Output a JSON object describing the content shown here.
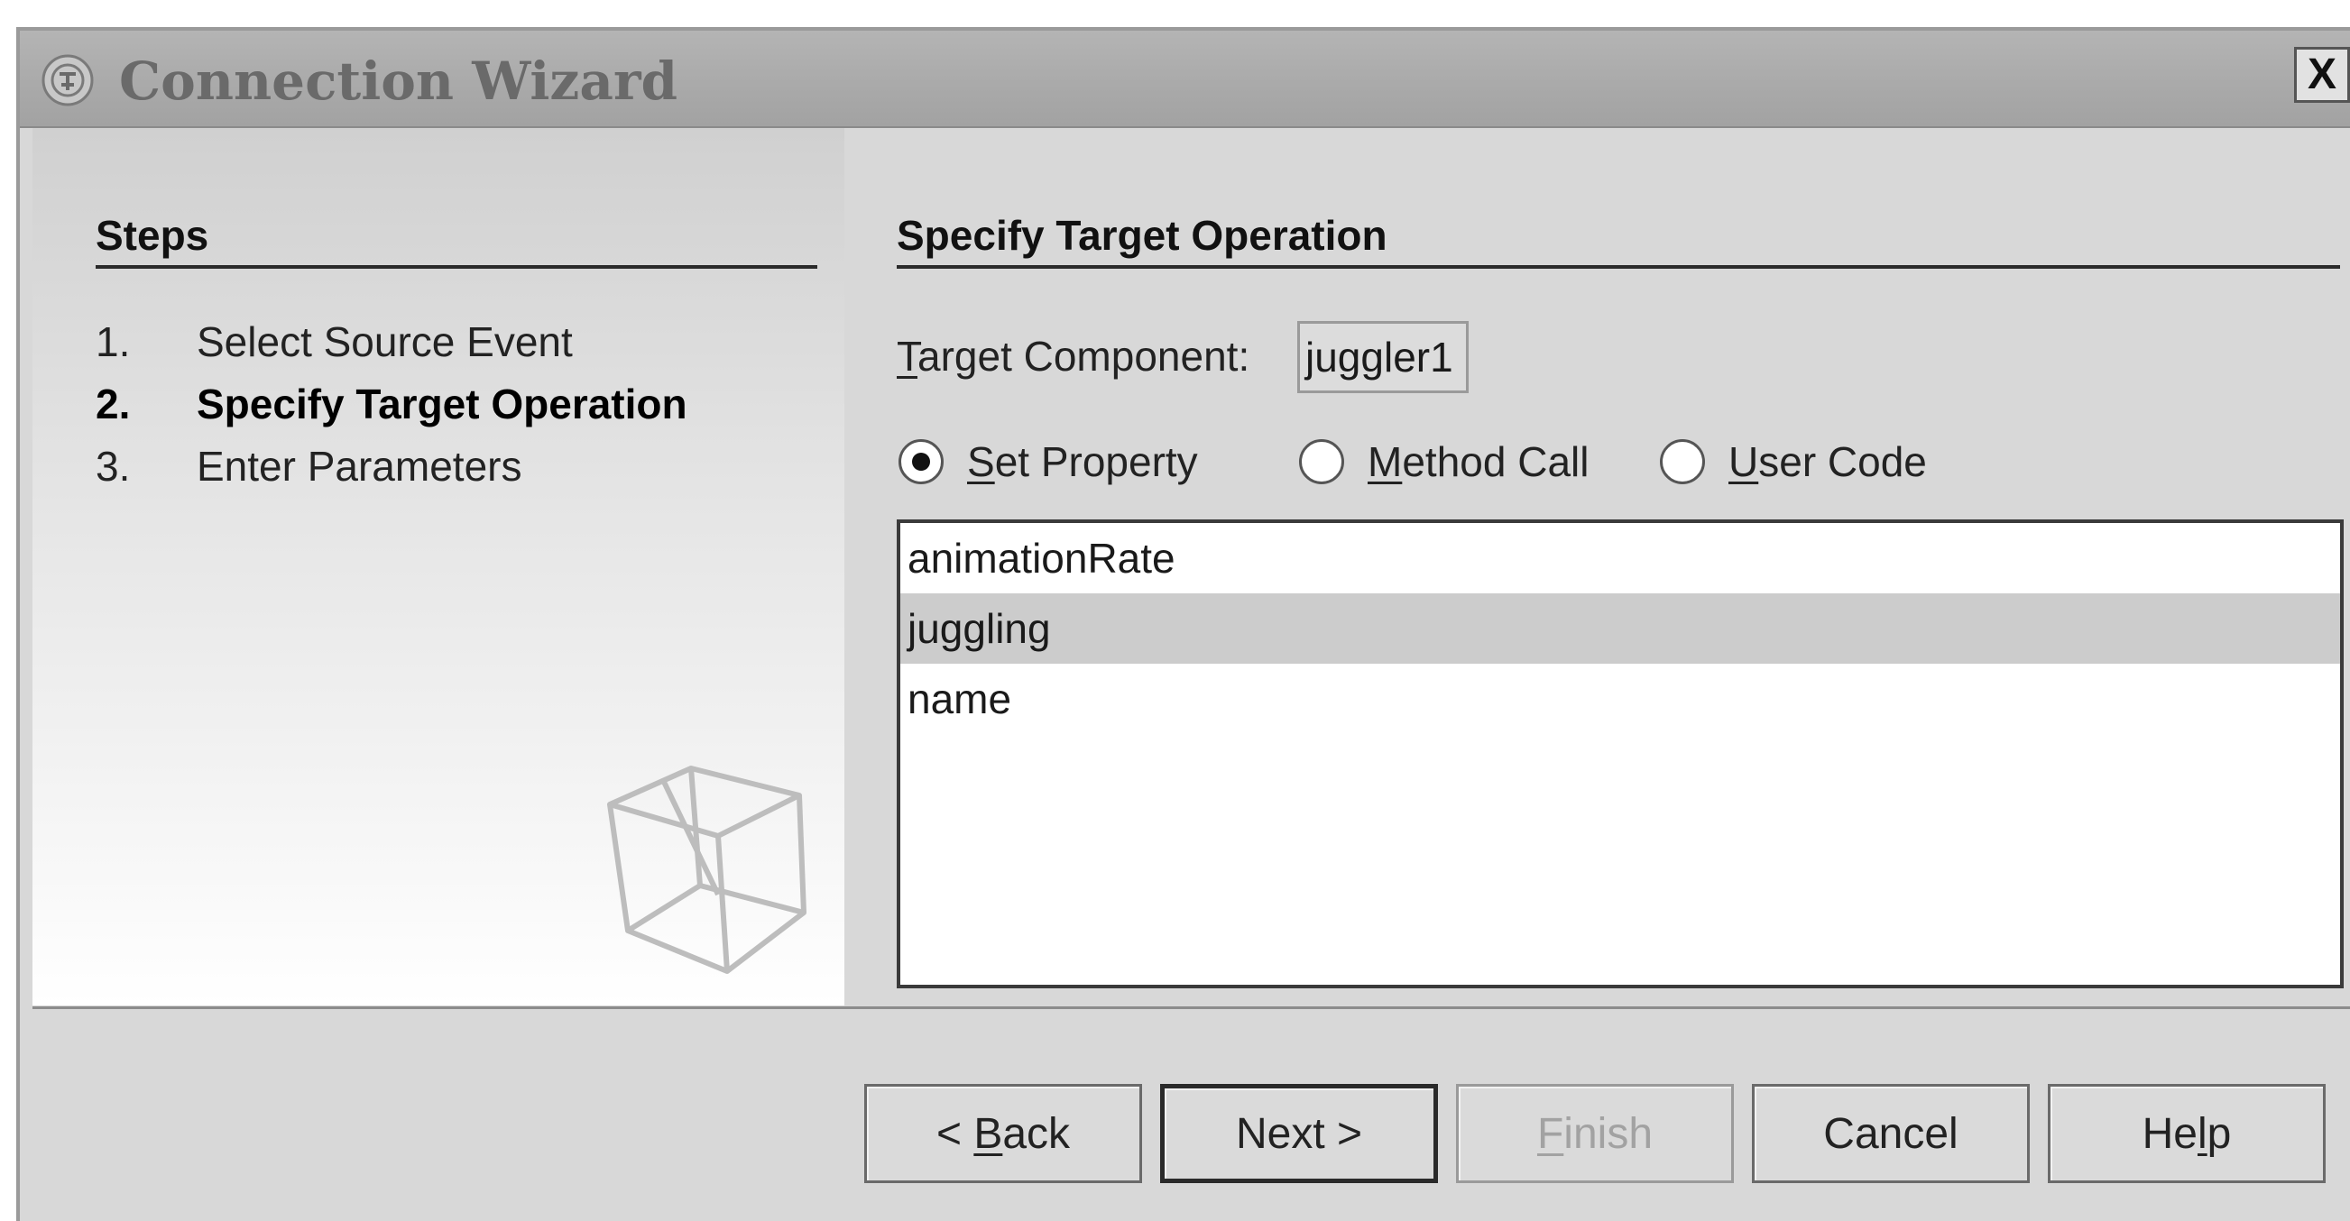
{
  "window": {
    "title": "Connection Wizard",
    "close_label": "X"
  },
  "steps": {
    "header": "Steps",
    "items": [
      {
        "number": "1.",
        "label": "Select Source Event",
        "current": false
      },
      {
        "number": "2.",
        "label": "Specify Target Operation",
        "current": true
      },
      {
        "number": "3.",
        "label": "Enter Parameters",
        "current": false
      }
    ]
  },
  "content": {
    "title": "Specify Target Operation",
    "target_component_label": "Target Component:",
    "target_component_value": "juggler1",
    "operation_options": [
      {
        "label": "Set Property",
        "selected": true
      },
      {
        "label": "Method Call",
        "selected": false
      },
      {
        "label": "User Code",
        "selected": false
      }
    ],
    "property_list": [
      "animationRate",
      "juggling",
      "name"
    ],
    "selected_property": "juggling"
  },
  "buttons": {
    "back": "< Back",
    "next": "Next >",
    "finish": "Finish",
    "cancel": "Cancel",
    "help": "Help"
  },
  "colors": {
    "title_text": "#6a6a6a",
    "window_bg": "#d8d8d8",
    "selection_bg": "#cccccc"
  }
}
